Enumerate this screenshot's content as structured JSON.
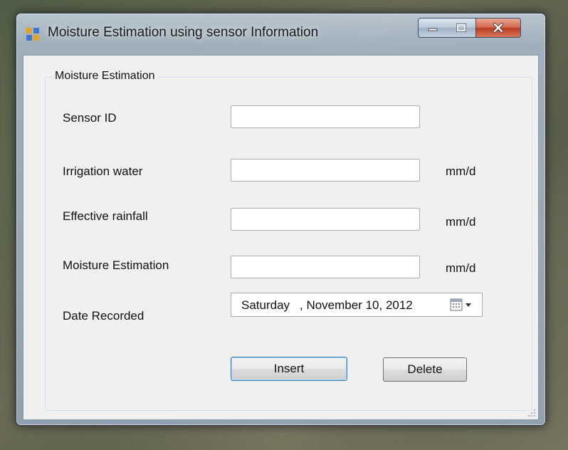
{
  "window": {
    "title": "Moisture Estimation using sensor Information",
    "controls": {
      "minimize_icon": "minimize-icon",
      "maximize_icon": "maximize-icon",
      "close_icon": "close-icon"
    }
  },
  "form": {
    "group_title": "Moisture Estimation",
    "fields": [
      {
        "label": "Sensor ID",
        "value": "",
        "unit": ""
      },
      {
        "label": "Irrigation water",
        "value": "",
        "unit": "mm/d"
      },
      {
        "label": "Effective rainfall",
        "value": "",
        "unit": "mm/d"
      },
      {
        "label": "Moisture Estimation",
        "value": "",
        "unit": "mm/d"
      }
    ],
    "date": {
      "label": "Date Recorded",
      "day": "Saturday",
      "rest": ",  November 10, 2012",
      "icon": "calendar-dropdown-icon"
    },
    "buttons": {
      "insert": "Insert",
      "delete": "Delete"
    }
  },
  "colors": {
    "close_button": "#c7452a",
    "title_text": "#1c1c1c",
    "focus_border": "#3c7fb1"
  }
}
